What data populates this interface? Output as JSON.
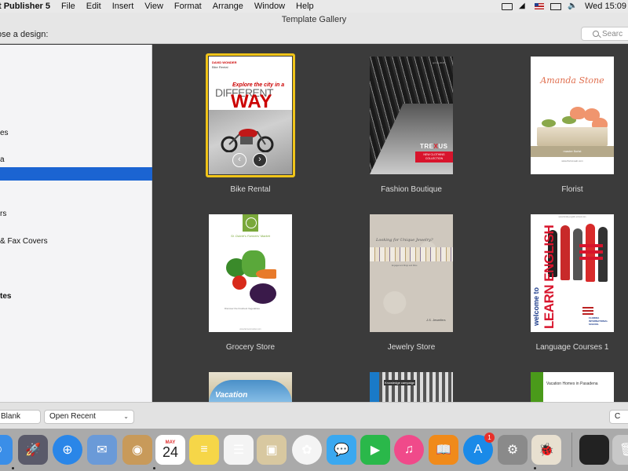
{
  "menubar": {
    "app_name": "t Publisher 5",
    "menus": [
      "File",
      "Edit",
      "Insert",
      "View",
      "Format",
      "Arrange",
      "Window",
      "Help"
    ],
    "clock": "Wed 15:09"
  },
  "window": {
    "title": "Template Gallery",
    "choose_label": "ose a design:",
    "search_placeholder": "Searc"
  },
  "sidebar": {
    "items": [
      {
        "label": "es",
        "selected": false,
        "header": false
      },
      {
        "label": "a",
        "selected": false,
        "header": false
      },
      {
        "label": "",
        "selected": true,
        "header": false
      },
      {
        "label": "rs",
        "selected": false,
        "header": false
      },
      {
        "label": "& Fax Covers",
        "selected": false,
        "header": false
      },
      {
        "label": "tes",
        "selected": false,
        "header": true
      }
    ]
  },
  "templates": [
    {
      "name": "Bike Rental",
      "selected": true,
      "thumb": {
        "brand": "DAVID WONDER",
        "sub": "Bike Rental",
        "line1": "Explore the city in a",
        "line2": "DIFFERENT",
        "line3": "WAY",
        "nav_left": "‹",
        "nav_right": "›"
      }
    },
    {
      "name": "Fashion Boutique",
      "selected": false,
      "thumb": {
        "season": "spring 2015",
        "brand_a": "TRE",
        "brand_x": "X",
        "brand_b": "US",
        "banner": "NEW CLOTHING COLLECTION"
      }
    },
    {
      "name": "Florist",
      "selected": false,
      "thumb": {
        "name": "Amanda Stone",
        "band": "master florist",
        "small": "www.florist-web.com"
      }
    },
    {
      "name": "Grocery Store",
      "selected": false,
      "thumb": {
        "title": "St. Dulcie's Farmers' Market",
        "foot": "Discover the Freshest Vegetables",
        "url": "www.farmersmarket.com"
      }
    },
    {
      "name": "Jewelry Store",
      "selected": false,
      "thumb": {
        "tagline": "Looking for Unique Jewelry?",
        "txt": "Engagement Rings and More",
        "sig": "J.S. Jewellers"
      }
    },
    {
      "name": "Language Courses 1",
      "selected": false,
      "thumb": {
        "url": "www.florida-english-school.com",
        "welcome": "welcome to",
        "learn": "LEARN ENGLISH",
        "school": "FLORIDA INTERNATIONAL SCHOOL"
      }
    },
    {
      "name": "",
      "selected": false,
      "thumb": {
        "word": "Vacation"
      }
    },
    {
      "name": "",
      "selected": false,
      "thumb": {
        "head": "Knowledge campaign"
      }
    },
    {
      "name": "",
      "selected": false,
      "thumb": {
        "txt": "Vacation Homes in Pasadena"
      }
    }
  ],
  "bottombar": {
    "blank_label": "Blank",
    "open_recent_label": "Open Recent",
    "right_label": "C"
  },
  "dock": {
    "items": [
      {
        "name": "finder",
        "glyph": "☺",
        "color": "#3a8ee8"
      },
      {
        "name": "launchpad",
        "glyph": "🚀",
        "color": "#5a5a6a"
      },
      {
        "name": "safari",
        "glyph": "⊕",
        "color": "#2a86e8"
      },
      {
        "name": "mail-stamp",
        "glyph": "✉",
        "color": "#6a9ad8"
      },
      {
        "name": "contacts",
        "glyph": "◉",
        "color": "#c89a5a"
      },
      {
        "name": "calendar",
        "glyph": "",
        "color": "#ffffff",
        "month": "MAY",
        "day": "24"
      },
      {
        "name": "notes",
        "glyph": "≡",
        "color": "#f6d648"
      },
      {
        "name": "reminders",
        "glyph": "☰",
        "color": "#f4f4f4"
      },
      {
        "name": "preview",
        "glyph": "▣",
        "color": "#d8c8a0"
      },
      {
        "name": "photos",
        "glyph": "✿",
        "color": "#f4f4f4"
      },
      {
        "name": "messages",
        "glyph": "💬",
        "color": "#3aa8f0"
      },
      {
        "name": "facetime",
        "glyph": "▶",
        "color": "#2ab84a"
      },
      {
        "name": "itunes",
        "glyph": "♫",
        "color": "#f04a8a"
      },
      {
        "name": "ibooks",
        "glyph": "📖",
        "color": "#f08a1a"
      },
      {
        "name": "app-store",
        "glyph": "A",
        "color": "#1a8ae8",
        "badge": "1"
      },
      {
        "name": "system-preferences",
        "glyph": "⚙",
        "color": "#8a8a8a"
      },
      {
        "name": "publisher",
        "glyph": "🐞",
        "color": "#e8e0d0"
      },
      {
        "name": "screen-thumbnail",
        "glyph": "",
        "color": "#222222"
      },
      {
        "name": "trash",
        "glyph": "🗑",
        "color": "#c8c8c8"
      }
    ]
  }
}
